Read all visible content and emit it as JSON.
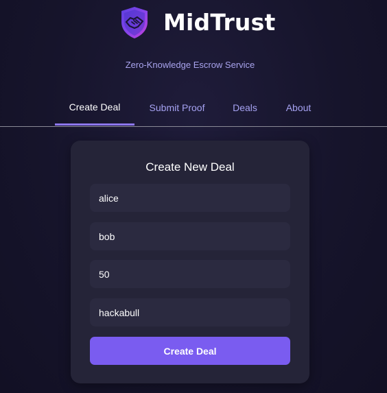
{
  "brand": {
    "name": "MidTrust",
    "tagline": "Zero-Knowledge Escrow Service",
    "logo_icon": "shield-handshake-icon",
    "logo_colors": [
      "#7a4cf0",
      "#c040e0",
      "#4a3ad0"
    ]
  },
  "nav": {
    "tabs": [
      {
        "label": "Create Deal",
        "active": true
      },
      {
        "label": "Submit Proof",
        "active": false
      },
      {
        "label": "Deals",
        "active": false
      },
      {
        "label": "About",
        "active": false
      }
    ]
  },
  "form": {
    "title": "Create New Deal",
    "fields": [
      {
        "value": "alice"
      },
      {
        "value": "bob"
      },
      {
        "value": "50"
      },
      {
        "value": "hackabull"
      }
    ],
    "submit_label": "Create Deal"
  },
  "colors": {
    "accent": "#7a5cf0",
    "tab_text": "#a6a2f2",
    "background": "#16142b",
    "card": "#252438",
    "field": "#2b2a40"
  }
}
